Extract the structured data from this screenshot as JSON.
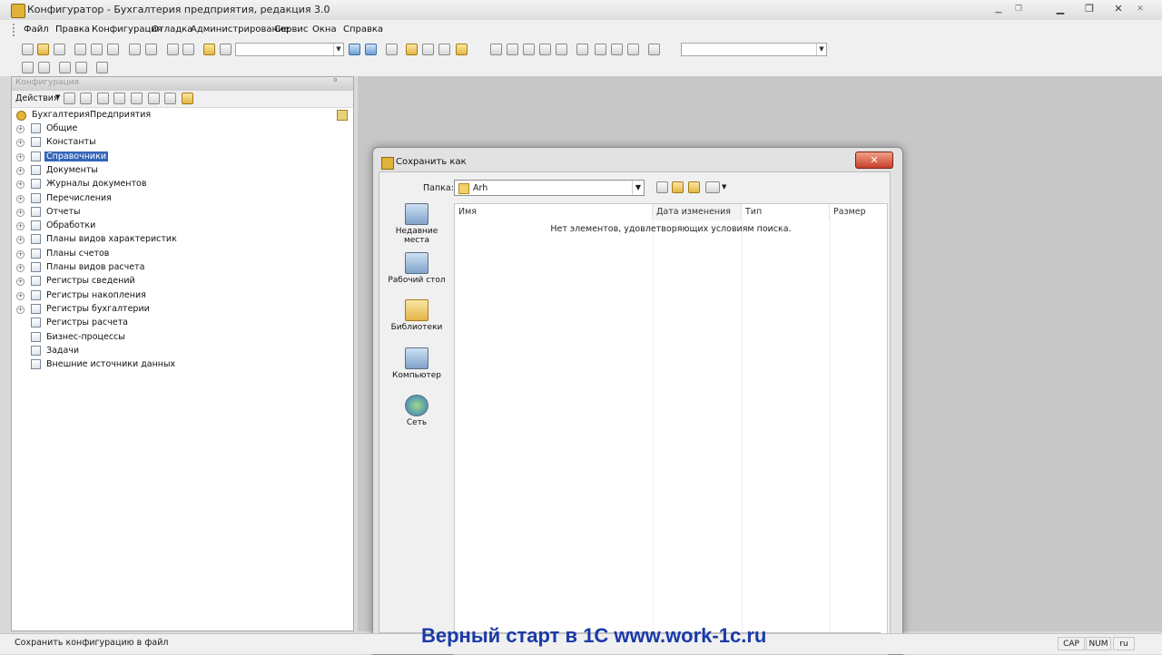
{
  "app": {
    "title": "Конфигуратор - Бухгалтерия предприятия, редакция 3.0"
  },
  "menu": {
    "items": [
      "Файл",
      "Правка",
      "Конфигурация",
      "Отладка",
      "Администрирование",
      "Сервис",
      "Окна",
      "Справка"
    ]
  },
  "left_panel": {
    "header": "Конфигурация",
    "header_pin": "⁰",
    "actions_label": "Действия",
    "root": "БухгалтерияПредприятия",
    "items": [
      {
        "label": "Общие",
        "icon": "common-icon",
        "expandable": true
      },
      {
        "label": "Константы",
        "icon": "constants-icon",
        "expandable": true
      },
      {
        "label": "Справочники",
        "icon": "catalogs-icon",
        "expandable": true,
        "selected": true
      },
      {
        "label": "Документы",
        "icon": "documents-icon",
        "expandable": true
      },
      {
        "label": "Журналы документов",
        "icon": "journals-icon",
        "expandable": true
      },
      {
        "label": "Перечисления",
        "icon": "enums-icon",
        "expandable": true
      },
      {
        "label": "Отчеты",
        "icon": "reports-icon",
        "expandable": true
      },
      {
        "label": "Обработки",
        "icon": "processing-icon",
        "expandable": true
      },
      {
        "label": "Планы видов характеристик",
        "icon": "chart-types-icon",
        "expandable": true
      },
      {
        "label": "Планы счетов",
        "icon": "chart-accounts-icon",
        "expandable": true
      },
      {
        "label": "Планы видов расчета",
        "icon": "calc-types-icon",
        "expandable": true
      },
      {
        "label": "Регистры сведений",
        "icon": "info-registers-icon",
        "expandable": true
      },
      {
        "label": "Регистры накопления",
        "icon": "accum-registers-icon",
        "expandable": true
      },
      {
        "label": "Регистры бухгалтерии",
        "icon": "acc-registers-icon",
        "expandable": true
      },
      {
        "label": "Регистры расчета",
        "icon": "calc-registers-icon",
        "expandable": false
      },
      {
        "label": "Бизнес-процессы",
        "icon": "business-process-icon",
        "expandable": false
      },
      {
        "label": "Задачи",
        "icon": "tasks-icon",
        "expandable": false
      },
      {
        "label": "Внешние источники данных",
        "icon": "external-data-icon",
        "expandable": false
      }
    ]
  },
  "dialog": {
    "title": "Сохранить как",
    "close": "✕",
    "folder_label": "Папка:",
    "folder_value": "Arh",
    "places": [
      "Недавние места",
      "Рабочий стол",
      "Библиотеки",
      "Компьютер",
      "Сеть"
    ],
    "columns": [
      "Имя",
      "Дата изменения",
      "Тип",
      "Размер"
    ],
    "empty_message": "Нет элементов, удовлетворяющих условиям поиска."
  },
  "status": {
    "text": "Сохранить конфигурацию в файл",
    "cap": "CAP",
    "num": "NUM",
    "lang": "ru"
  },
  "watermark": "Верный старт в 1С www.work-1c.ru"
}
